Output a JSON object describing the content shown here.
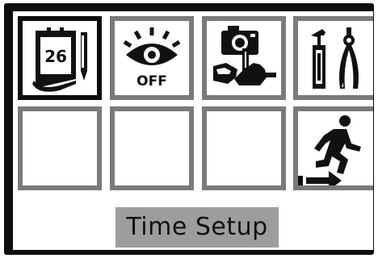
{
  "menu": {
    "items": [
      {
        "id": "time-setup",
        "icon": "calendar-icon",
        "icon_text": "26",
        "selected": true
      },
      {
        "id": "eye-off",
        "icon": "eye-off-icon",
        "icon_text": "OFF",
        "selected": false
      },
      {
        "id": "capture",
        "icon": "hand-camera-icon",
        "selected": false
      },
      {
        "id": "tools",
        "icon": "tools-icon",
        "selected": false
      },
      {
        "id": "empty-1",
        "icon": "",
        "selected": false
      },
      {
        "id": "empty-2",
        "icon": "",
        "selected": false
      },
      {
        "id": "empty-3",
        "icon": "",
        "selected": false
      },
      {
        "id": "exit",
        "icon": "exit-icon",
        "selected": false
      }
    ]
  },
  "caption": {
    "label": "Time Setup"
  },
  "colors": {
    "bezel": "#0d0d0d",
    "tile_border": "#7a7a7a",
    "selected_border": "#0d0d0d",
    "caption_bg": "#9d9d9d"
  }
}
